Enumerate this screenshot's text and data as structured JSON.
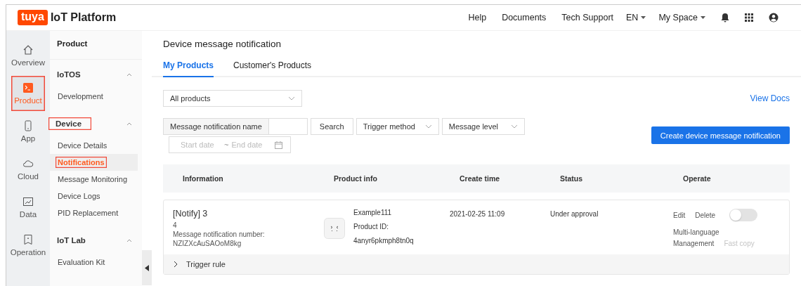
{
  "header": {
    "logo": "tuya",
    "title": "IoT Platform",
    "links": [
      "Help",
      "Documents",
      "Tech Support"
    ],
    "menus": [
      "EN",
      "My Space"
    ]
  },
  "rail": [
    {
      "label": "Overview",
      "selected": false,
      "highlighted": false
    },
    {
      "label": "Product",
      "selected": true,
      "highlighted": true
    },
    {
      "label": "App",
      "selected": false,
      "highlighted": false
    },
    {
      "label": "Cloud",
      "selected": false,
      "highlighted": false
    },
    {
      "label": "Data",
      "selected": false,
      "highlighted": false
    },
    {
      "label": "Operation",
      "selected": false,
      "highlighted": false
    }
  ],
  "sidebar": {
    "title": "Product",
    "groups": [
      {
        "label": "IoTOS",
        "expanded": true,
        "highlighted": false,
        "items": [
          {
            "label": "Development",
            "selected": false,
            "highlighted": false
          }
        ]
      },
      {
        "label": "Device",
        "expanded": true,
        "highlighted": true,
        "items": [
          {
            "label": "Device Details",
            "selected": false,
            "highlighted": false
          },
          {
            "label": "Notifications",
            "selected": true,
            "highlighted": true
          },
          {
            "label": "Message Monitoring",
            "selected": false,
            "highlighted": false
          },
          {
            "label": "Device Logs",
            "selected": false,
            "highlighted": false
          },
          {
            "label": "PID Replacement",
            "selected": false,
            "highlighted": false
          }
        ]
      },
      {
        "label": "IoT Lab",
        "expanded": true,
        "highlighted": false,
        "items": [
          {
            "label": "Evaluation Kit",
            "selected": false,
            "highlighted": false
          }
        ]
      }
    ]
  },
  "page": {
    "title": "Device message notification",
    "tabs": [
      {
        "label": "My Products",
        "selected": true
      },
      {
        "label": "Customer's Products",
        "selected": false
      }
    ],
    "product_select": "All products",
    "view_docs": "View Docs",
    "filters": {
      "name_label": "Message notification name",
      "search": "Search",
      "trigger_method": "Trigger method",
      "message_level": "Message level",
      "start_placeholder": "Start date",
      "separator": "~",
      "end_placeholder": "End date"
    },
    "create_button": "Create device message notification"
  },
  "table": {
    "columns": [
      "Information",
      "Product info",
      "Create time",
      "Status",
      "Operate"
    ],
    "rows": [
      {
        "title": "[Notify] 3",
        "subtitle": "4",
        "number_label": "Message notification number:",
        "number": "NZIZXcAuSAOoM8kg",
        "product": "Example111",
        "product_id_label": "Product ID:",
        "product_id": "4anyr6pkmph8tn0q",
        "create_time": "2021-02-25 11:09",
        "status": "Under approval",
        "actions": [
          "Edit",
          "Delete"
        ],
        "on": false,
        "more_actions": [
          {
            "label": "Multi-language",
            "disabled": false
          },
          {
            "label": "Management",
            "disabled": false
          },
          {
            "label": "Fast copy",
            "disabled": true
          }
        ],
        "trigger_rule": "Trigger rule",
        "expanded": false
      }
    ]
  }
}
